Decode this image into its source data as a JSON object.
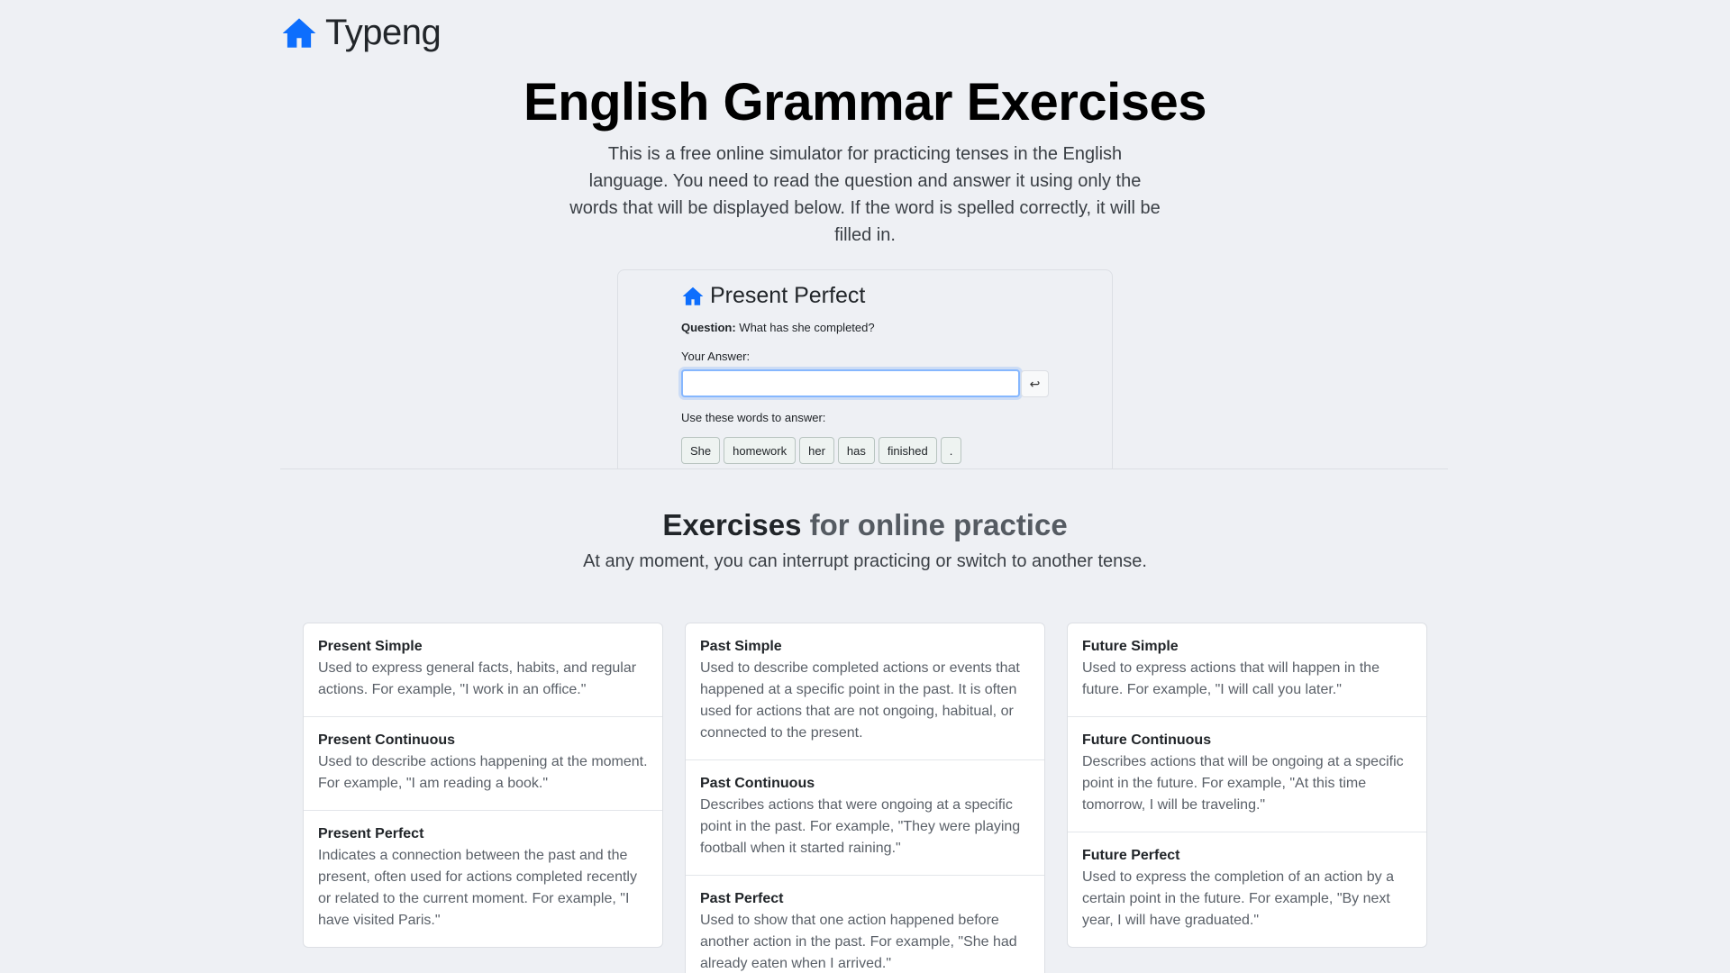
{
  "brand": {
    "name": "Typeng",
    "icon": "home-icon",
    "icon_color": "#0d6efd"
  },
  "hero": {
    "title": "English Grammar Exercises",
    "description": "This is a free online simulator for practicing tenses in the English language. You need to read the question and answer it using only the words that will be displayed below. If the word is spelled correctly, it will be filled in."
  },
  "demo": {
    "title": "Present Perfect",
    "question_label": "Question:",
    "question_text": "What has she completed?",
    "answer_label": "Your Answer:",
    "answer_value": "",
    "enter_icon": "return-arrow-icon",
    "enter_glyph": "↩",
    "words_label": "Use these words to answer:",
    "words": [
      "She",
      "homework",
      "her",
      "has",
      "finished",
      "."
    ]
  },
  "section": {
    "title_strong": "Exercises",
    "title_muted": "for online practice",
    "subtitle": "At any moment, you can interrupt practicing or switch to another tense."
  },
  "columns": [
    [
      {
        "name": "Present Simple",
        "desc": "Used to express general facts, habits, and regular actions. For example, \"I work in an office.\""
      },
      {
        "name": "Present Continuous",
        "desc": "Used to describe actions happening at the moment. For example, \"I am reading a book.\""
      },
      {
        "name": "Present Perfect",
        "desc": "Indicates a connection between the past and the present, often used for actions completed recently or related to the current moment. For example, \"I have visited Paris.\""
      }
    ],
    [
      {
        "name": "Past Simple",
        "desc": "Used to describe completed actions or events that happened at a specific point in the past. It is often used for actions that are not ongoing, habitual, or connected to the present."
      },
      {
        "name": "Past Continuous",
        "desc": "Describes actions that were ongoing at a specific point in the past. For example, \"They were playing football when it started raining.\""
      },
      {
        "name": "Past Perfect",
        "desc": "Used to show that one action happened before another action in the past. For example, \"She had already eaten when I arrived.\""
      }
    ],
    [
      {
        "name": "Future Simple",
        "desc": "Used to express actions that will happen in the future. For example, \"I will call you later.\""
      },
      {
        "name": "Future Continuous",
        "desc": "Describes actions that will be ongoing at a specific point in the future. For example, \"At this time tomorrow, I will be traveling.\""
      },
      {
        "name": "Future Perfect",
        "desc": "Used to express the completion of an action by a certain point in the future. For example, \"By next year, I will have graduated.\""
      }
    ]
  ]
}
